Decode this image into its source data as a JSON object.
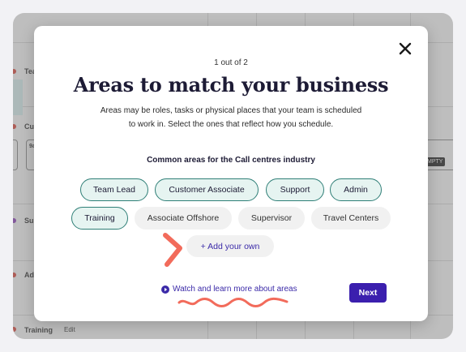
{
  "background": {
    "row_labels": [
      "Tea",
      "Cu",
      "Su",
      "Ad",
      "Training"
    ],
    "edit_label": "Edit",
    "cell_text": "9a",
    "badge_text": "MPTY",
    "dot_colors": [
      "#d9453b",
      "#d9453b",
      "#8a3fb8",
      "#d9453b",
      "#d9453b"
    ]
  },
  "modal": {
    "step_label": "1 out of 2",
    "title": "Areas to match your business",
    "description": "Areas may be roles, tasks or physical places that your team is scheduled to work in. Select the ones that reflect how you schedule.",
    "subheading": "Common areas for the Call centres industry",
    "chips": [
      {
        "label": "Team Lead",
        "selected": true
      },
      {
        "label": "Customer Associate",
        "selected": true
      },
      {
        "label": "Support",
        "selected": true
      },
      {
        "label": "Admin",
        "selected": true
      },
      {
        "label": "Training",
        "selected": true
      },
      {
        "label": "Associate Offshore",
        "selected": false
      },
      {
        "label": "Supervisor",
        "selected": false
      },
      {
        "label": "Travel Centers",
        "selected": false
      }
    ],
    "add_own_label": "+ Add your own",
    "watch_link_label": "Watch and learn more about areas",
    "next_label": "Next"
  },
  "colors": {
    "accent": "#3b1fae",
    "selected_border": "#2f7f77",
    "annotation": "#f26b5b"
  }
}
